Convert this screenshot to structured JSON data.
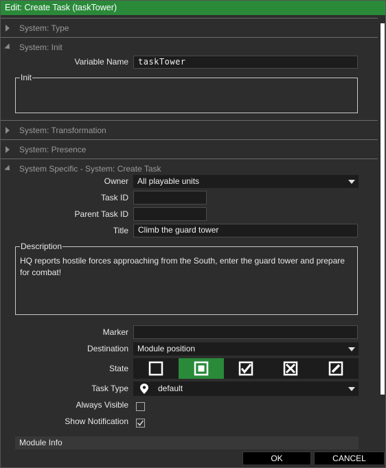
{
  "window": {
    "title": "Edit: Create Task (taskTower)"
  },
  "sections": {
    "type": "System: Type",
    "init": "System: Init",
    "transformation": "System: Transformation",
    "presence": "System: Presence",
    "specific": "System Specific - System: Create Task"
  },
  "init": {
    "variable_name_label": "Variable Name",
    "variable_name_value": "taskTower",
    "init_group_label": "Init",
    "init_value": ""
  },
  "task": {
    "owner_label": "Owner",
    "owner_value": "All playable units",
    "task_id_label": "Task ID",
    "task_id_value": "",
    "parent_task_id_label": "Parent Task ID",
    "parent_task_id_value": "",
    "title_label": "Title",
    "title_value": "Climb the guard tower",
    "description_label": "Description",
    "description_value": "HQ reports hostile forces approaching from the South, enter the guard tower and prepare for combat!",
    "marker_label": "Marker",
    "marker_value": "",
    "destination_label": "Destination",
    "destination_value": "Module position",
    "state_label": "State",
    "state_options": [
      "none",
      "assigned",
      "succeeded",
      "failed",
      "canceled"
    ],
    "state_selected": "assigned",
    "task_type_label": "Task Type",
    "task_type_value": "default",
    "always_visible_label": "Always Visible",
    "always_visible_checked": false,
    "show_notification_label": "Show Notification",
    "show_notification_checked": true
  },
  "module_info": {
    "label": "Module Info"
  },
  "footer": {
    "ok_label": "OK",
    "cancel_label": "CANCEL"
  },
  "icons": {
    "section_collapsed": "triangle-right-icon",
    "section_expanded": "triangle-down-icon",
    "dropdown": "chevron-down-icon",
    "task_type": "map-pin-icon",
    "state_none": "empty-square-icon",
    "state_assigned": "square-in-square-icon",
    "state_succeeded": "checkmark-icon",
    "state_failed": "x-icon",
    "state_canceled": "pencil-icon"
  },
  "colors": {
    "accent": "#2a8a3a",
    "background": "#2d2d2d",
    "field": "#1c1c1c"
  }
}
